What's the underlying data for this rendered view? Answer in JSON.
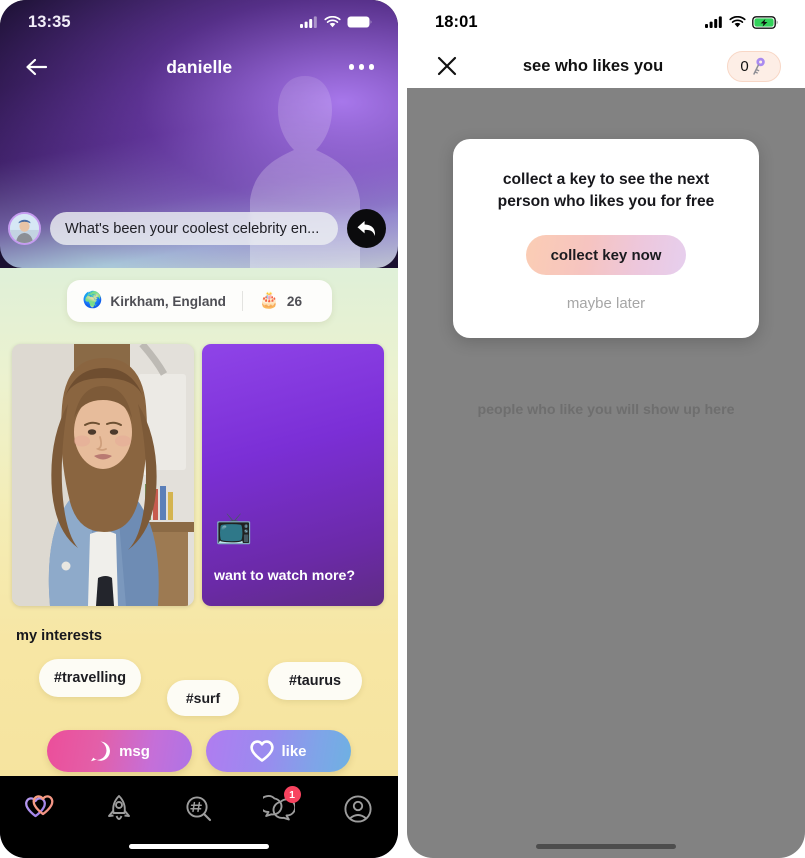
{
  "left_phone": {
    "status": {
      "time": "13:35",
      "signal_icon": "cellular-signal-icon",
      "wifi_icon": "wifi-icon",
      "battery_icon": "battery-full-icon"
    },
    "header": {
      "back_icon": "back-arrow-icon",
      "title": "danielle",
      "more_icon": "more-options-icon"
    },
    "prompt": {
      "avatar_name": "prompt-avatar",
      "text": "What's been your coolest celebrity en...",
      "reply_icon": "reply-arrow-icon"
    },
    "info": {
      "location_emoji": "🌍",
      "location": "Kirkham, England",
      "age_emoji": "🎂",
      "age": "26"
    },
    "cards": {
      "photo_alt": "profile-photo",
      "watch_emoji": "📺",
      "watch_label": "want to watch more?"
    },
    "interests": {
      "title": "my interests",
      "tags": [
        "#travelling",
        "#surf",
        "#taurus"
      ]
    },
    "actions": {
      "msg_label": "msg",
      "msg_icon": "speech-bubble-icon",
      "like_label": "like",
      "like_icon": "heart-icon"
    },
    "tabs": [
      {
        "name": "tab-matches",
        "icon": "double-heart-icon",
        "active": true,
        "badge": ""
      },
      {
        "name": "tab-boost",
        "icon": "rocket-icon",
        "active": false,
        "badge": ""
      },
      {
        "name": "tab-discover",
        "icon": "hashtag-search-icon",
        "active": false,
        "badge": ""
      },
      {
        "name": "tab-chats",
        "icon": "chat-bubbles-icon",
        "active": false,
        "badge": "1"
      },
      {
        "name": "tab-profile",
        "icon": "profile-circle-icon",
        "active": false,
        "badge": ""
      }
    ]
  },
  "right_phone": {
    "status": {
      "time": "18:01",
      "signal_icon": "cellular-signal-icon",
      "wifi_icon": "wifi-icon",
      "battery_icon": "battery-charging-icon"
    },
    "header": {
      "close_icon": "close-icon",
      "title": "see who likes you",
      "key_count": "0",
      "key_icon": "key-icon"
    },
    "modal": {
      "title": "collect a key to see the next person who likes you for free",
      "primary_label": "collect key now",
      "secondary_label": "maybe later"
    },
    "empty_state": "people who like you will show up here"
  },
  "colors": {
    "accent_pink": "#ec4e9a",
    "accent_purple": "#8f44e8",
    "badge_red": "#f8435f",
    "key_pill_bg": "#fdeee6",
    "overlay_gray": "#828282",
    "battery_green": "#32d15a"
  }
}
